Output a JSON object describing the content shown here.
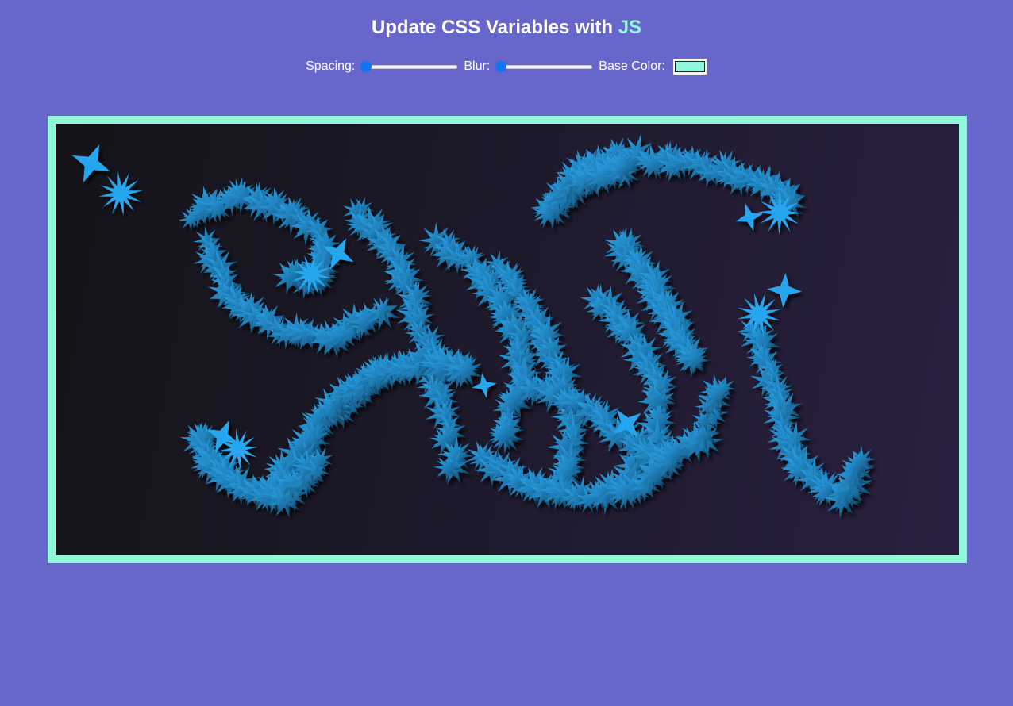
{
  "header": {
    "title_prefix": "Update CSS Variables with ",
    "title_highlight": "JS"
  },
  "controls": {
    "spacing_label": "Spacing:",
    "spacing_value": 0,
    "blur_label": "Blur:",
    "blur_value": 0,
    "base_color_label": "Base Color:",
    "base_color": "#8FF7DA"
  },
  "colors": {
    "page_background": "#6766CB",
    "accent": "#8FF7DA",
    "slider_thumb": "#1374F0",
    "image_star": "#27A6EE",
    "image_background": "#1e1a2c"
  },
  "image": {
    "subject": "tangled spiky blue star-shaped tendrils on a dark background",
    "icon": "image-icon"
  }
}
